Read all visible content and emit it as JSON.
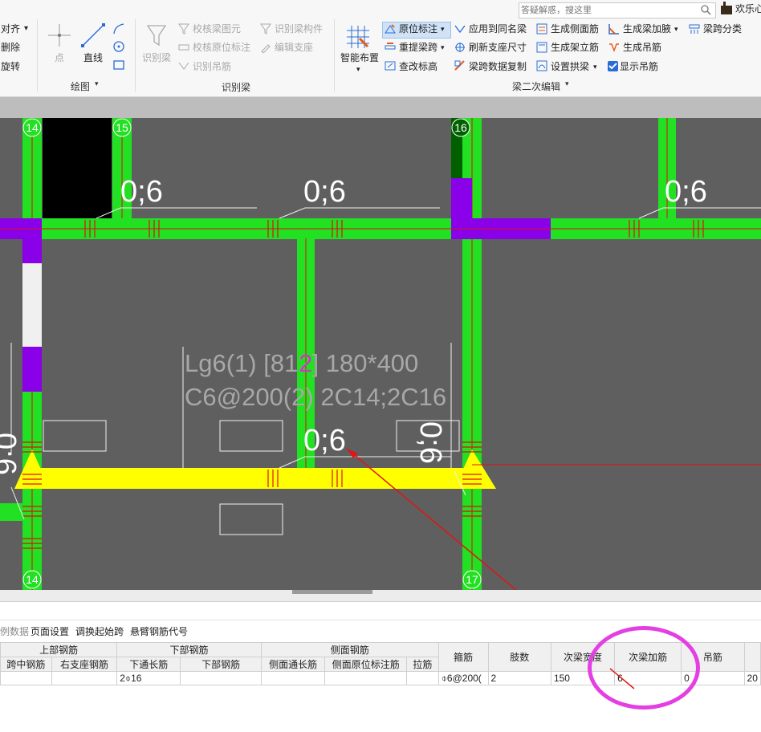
{
  "search": {
    "placeholder": "答疑解惑，搜这里"
  },
  "user": {
    "name": "欢乐心"
  },
  "ribbon": {
    "left_col": [
      "对齐",
      "删除",
      "旋转"
    ],
    "draw": {
      "point": "点",
      "line": "直线",
      "group": "绘图"
    },
    "identify": {
      "big": "识别梁",
      "items": [
        "校核梁图元",
        "校核原位标注",
        "识别吊筋",
        "识别梁构件",
        "编辑支座"
      ],
      "group": "识别梁"
    },
    "smart": {
      "label": "智能布置"
    },
    "edit2": {
      "col1": [
        "原位标注",
        "重提梁跨",
        "查改标高"
      ],
      "col2": [
        "应用到同名梁",
        "刷新支座尺寸",
        "梁跨数据复制"
      ],
      "col3": [
        "生成侧面筋",
        "生成架立筋",
        "设置拱梁"
      ],
      "col4": [
        "生成梁加腋",
        "生成吊筋",
        "显示吊筋"
      ],
      "col5": [
        "梁跨分类"
      ],
      "group": "梁二次编辑"
    }
  },
  "canvas": {
    "axis_labels": {
      "a": "14",
      "b": "15",
      "c": "16",
      "d": "14",
      "e": "17"
    },
    "tags": [
      "0;6",
      "0;6",
      "0;6",
      "0;6",
      "0;6",
      "0;6",
      "0;6"
    ],
    "beam_label_1": "Lg6(1) [812] 180*400",
    "beam_label_2": "C6@200(2) 2C14;2C16",
    "beam_label_highlight": "2"
  },
  "bottom": {
    "toolbar": [
      "例数据",
      "页面设置",
      "调换起始跨",
      "悬臂钢筋代号"
    ],
    "headers_top": [
      "上部钢筋",
      "下部钢筋",
      "侧面钢筋"
    ],
    "headers_sub": [
      "跨中钢筋",
      "右支座钢筋",
      "下通长筋",
      "下部钢筋",
      "侧面通长筋",
      "侧面原位标注筋",
      "拉筋"
    ],
    "headers_single": [
      "箍筋",
      "肢数",
      "次梁宽度",
      "次梁加筋",
      "吊筋"
    ],
    "row": [
      "",
      "",
      "2⌽16",
      "",
      "",
      "",
      "",
      "⌽6@200(",
      "2",
      "150",
      "6",
      "0",
      "20"
    ]
  },
  "colors": {
    "beam": "#22e022",
    "selected": "#ffff00",
    "column": "#8a00e8",
    "accent": "#e43fe3",
    "canvas": "#5f5f5f"
  }
}
